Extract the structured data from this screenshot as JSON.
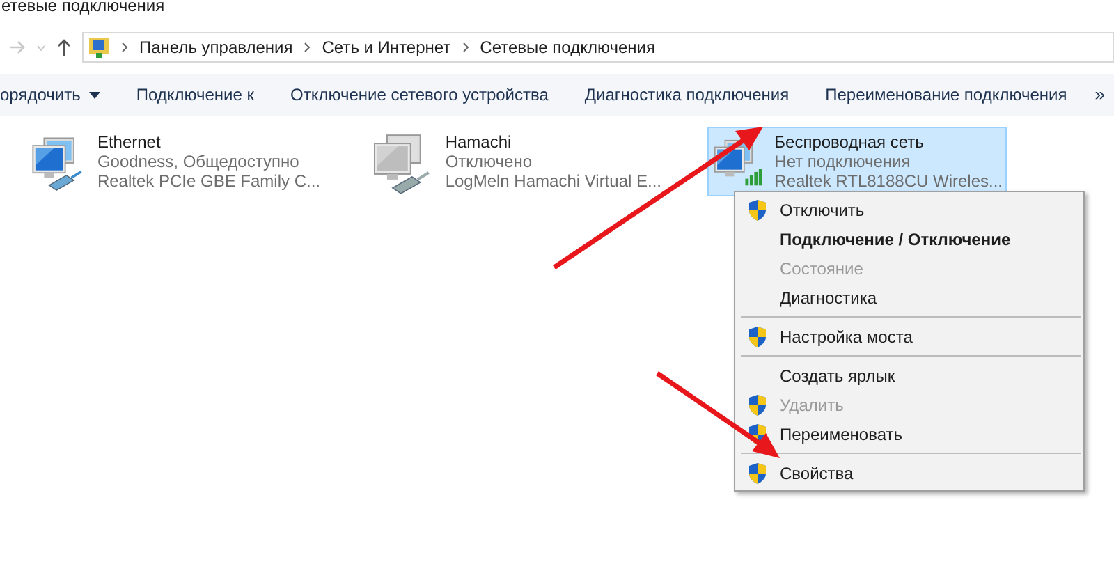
{
  "window": {
    "title": "етевые подключения"
  },
  "breadcrumb": [
    "Панель управления",
    "Сеть и Интернет",
    "Сетевые подключения"
  ],
  "toolbar": [
    {
      "label": "орядочить",
      "dropdown": true
    },
    {
      "label": "Подключение к",
      "dropdown": false
    },
    {
      "label": "Отключение сетевого устройства",
      "dropdown": false
    },
    {
      "label": "Диагностика подключения",
      "dropdown": false
    },
    {
      "label": "Переименование подключения",
      "dropdown": false
    }
  ],
  "toolbar_more": "»",
  "adapters": [
    {
      "name": "Ethernet",
      "status": "Goodness, Общедоступно",
      "device": "Realtek PCIe GBE Family C...",
      "kind": "wired",
      "selected": false
    },
    {
      "name": "Hamachi",
      "status": "Отключено",
      "device": "LogMeln Hamachi Virtual E...",
      "kind": "disabled",
      "selected": false
    },
    {
      "name": "Беспроводная сеть",
      "status": "Нет подключения",
      "device": "Realtek RTL8188CU Wireles...",
      "kind": "wireless",
      "selected": true
    }
  ],
  "context_menu": [
    {
      "kind": "item",
      "label": "Отключить",
      "shield": true,
      "bold": false,
      "disabled": false
    },
    {
      "kind": "item",
      "label": "Подключение / Отключение",
      "shield": false,
      "bold": true,
      "disabled": false
    },
    {
      "kind": "item",
      "label": "Состояние",
      "shield": false,
      "bold": false,
      "disabled": true
    },
    {
      "kind": "item",
      "label": "Диагностика",
      "shield": false,
      "bold": false,
      "disabled": false
    },
    {
      "kind": "separator"
    },
    {
      "kind": "item",
      "label": "Настройка моста",
      "shield": true,
      "bold": false,
      "disabled": false
    },
    {
      "kind": "separator"
    },
    {
      "kind": "item",
      "label": "Создать ярлык",
      "shield": false,
      "bold": false,
      "disabled": false
    },
    {
      "kind": "item",
      "label": "Удалить",
      "shield": true,
      "bold": false,
      "disabled": true
    },
    {
      "kind": "item",
      "label": "Переименовать",
      "shield": true,
      "bold": false,
      "disabled": false
    },
    {
      "kind": "separator"
    },
    {
      "kind": "item",
      "label": "Свойства",
      "shield": true,
      "bold": false,
      "disabled": false
    }
  ]
}
